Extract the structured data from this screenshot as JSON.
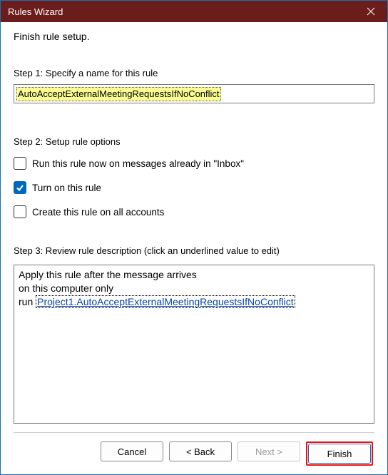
{
  "titlebar": {
    "title": "Rules Wizard"
  },
  "subheading": "Finish rule setup.",
  "step1": {
    "label": "Step 1: Specify a name for this rule",
    "value": "AutoAcceptExternalMeetingRequestsIfNoConflict"
  },
  "step2": {
    "label": "Step 2: Setup rule options",
    "opt_run_now": "Run this rule now on messages already in \"Inbox\"",
    "opt_turn_on": "Turn on this rule",
    "opt_all_accounts": "Create this rule on all accounts"
  },
  "step3": {
    "label": "Step 3: Review rule description (click an underlined value to edit)",
    "line1": "Apply this rule after the message arrives",
    "line2": "on this computer only",
    "line3_prefix": "run ",
    "line3_link": "Project1.AutoAcceptExternalMeetingRequestsIfNoConflict"
  },
  "buttons": {
    "cancel": "Cancel",
    "back": "< Back",
    "next": "Next >",
    "finish": "Finish"
  }
}
